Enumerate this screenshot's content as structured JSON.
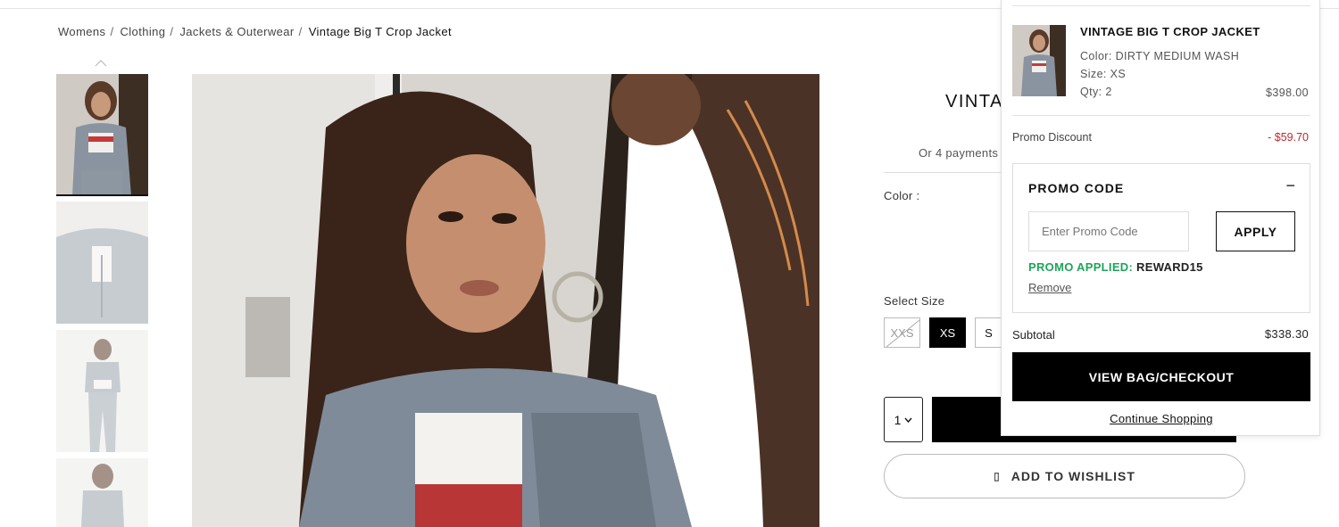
{
  "breadcrumb": {
    "items": [
      "Womens",
      "Clothing",
      "Jackets & Outerwear"
    ],
    "separator": "/",
    "current": "Vintage Big T Crop Jacket"
  },
  "product": {
    "title_visible": "VINTAG",
    "payments_visible": "Or 4 payments",
    "color_label": "Color :",
    "size_label": "Select Size",
    "sizes": [
      "XXS",
      "XS",
      "S"
    ],
    "selected_size": "XS",
    "unavailable_sizes": [
      "XXS"
    ],
    "quantity": "1",
    "wishlist_label": "ADD TO WISHLIST"
  },
  "minicart": {
    "item": {
      "name": "VINTAGE BIG T CROP JACKET",
      "color": "Color: DIRTY MEDIUM WASH",
      "size": "Size: XS",
      "qty": "Qty: 2",
      "price": "$398.00"
    },
    "promo_discount_label": "Promo Discount",
    "promo_discount_value": "- $59.70",
    "promo_code": {
      "title": "PROMO CODE",
      "toggle": "−",
      "placeholder": "Enter Promo Code",
      "apply_label": "APPLY",
      "applied_label": "PROMO APPLIED:",
      "applied_code": "REWARD15",
      "remove_label": "Remove"
    },
    "subtotal_label": "Subtotal",
    "subtotal_value": "$338.30",
    "checkout_label": "VIEW BAG/CHECKOUT",
    "continue_label": "Continue Shopping"
  },
  "colors": {
    "promo_green": "#1ea45a",
    "discount_red": "#c0282d",
    "primary_black": "#000000"
  }
}
